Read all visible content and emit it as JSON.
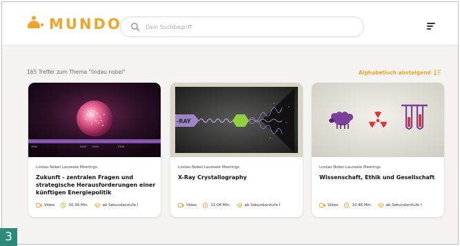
{
  "header": {
    "logo_text": "MUNDO",
    "search_placeholder": "Dein Suchbegriff"
  },
  "results": {
    "count_text": "165 Treffer zum Thema \"lindau nobel\"",
    "sort_label": "Alphabetisch absteigend"
  },
  "cards": [
    {
      "category": "Lindau Nobel Laureate Meetings",
      "title": "Zukunft - zentralen Fragen und strategische Herausforderungen einer künftigen Energiepolitik",
      "type": "Video",
      "duration": "10:36 Min.",
      "level": "ab Sekundarstufe I",
      "timeline_labels": [
        "1990",
        "2000",
        "2014",
        "2100"
      ]
    },
    {
      "category": "Lindau Nobel Laureate Meetings",
      "title": "X-Ray Crystallography",
      "type": "Video",
      "duration": "11:06 Min.",
      "level": "ab Sekundarstufe I",
      "thumb_label": "-RAY"
    },
    {
      "category": "Lindau Nobel Laureate Meetings",
      "title": "Wissenschaft, Ethik und Gesellschaft",
      "type": "Video",
      "duration": "10:46 Min.",
      "level": "ab Sekundarstufe I"
    }
  ],
  "figure_number": "3",
  "colors": {
    "accent": "#f0a42a",
    "badge": "#2b8a78",
    "purple": "#7a3f98",
    "radiation": "#e4323b"
  }
}
